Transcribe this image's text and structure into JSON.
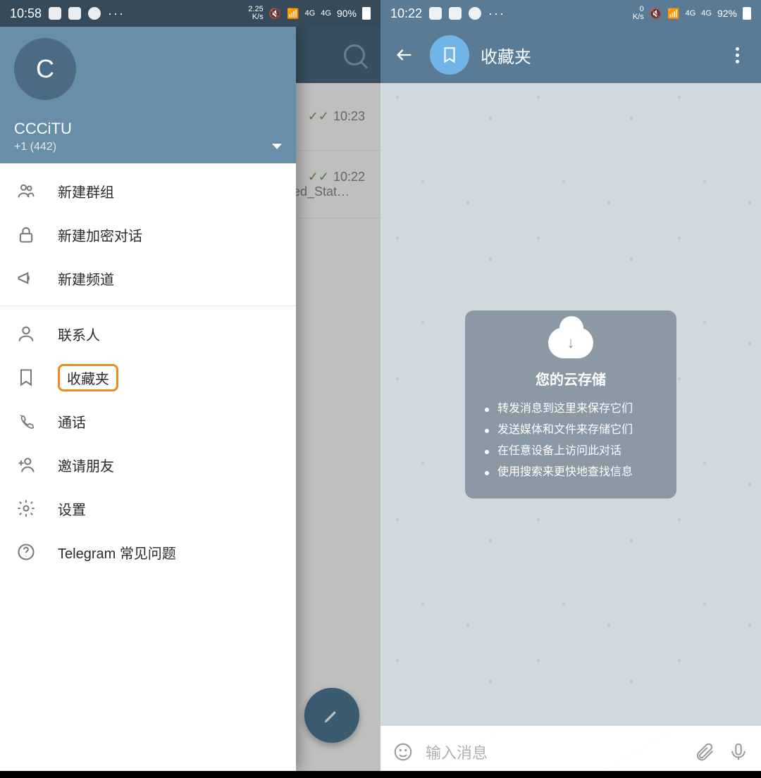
{
  "left": {
    "status": {
      "time": "10:58",
      "speed": "2.25\nK/s",
      "battery": "90%",
      "net_label": "4G"
    },
    "chat_rows": [
      {
        "time": "10:23",
        "checked": true
      },
      {
        "time": "10:22",
        "checked": true,
        "preview": "ed_Stat…"
      }
    ],
    "user": {
      "initial": "C",
      "name": "CCCiTU",
      "phone": "+1 (442)"
    },
    "menu": {
      "new_group": "新建群组",
      "new_secret": "新建加密对话",
      "new_channel": "新建频道",
      "contacts": "联系人",
      "saved": "收藏夹",
      "calls": "通话",
      "invite": "邀请朋友",
      "settings": "设置",
      "faq": "Telegram 常见问题"
    }
  },
  "right": {
    "status": {
      "time": "10:22",
      "speed": "0\nK/s",
      "battery": "92%",
      "net_label": "4G"
    },
    "header": {
      "title": "收藏夹"
    },
    "card": {
      "title": "您的云存储",
      "items": [
        "转发消息到这里来保存它们",
        "发送媒体和文件来存储它们",
        "在任意设备上访问此对话",
        "使用搜索来更快地查找信息"
      ]
    },
    "input": {
      "placeholder": "输入消息"
    }
  }
}
